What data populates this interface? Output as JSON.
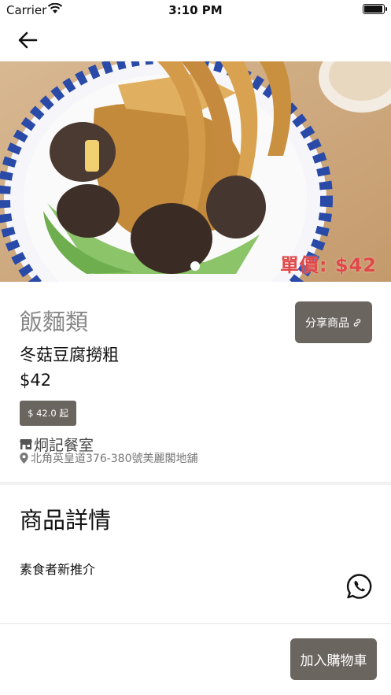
{
  "status_bar": {
    "carrier": "Carrier",
    "time": "3:10 PM"
  },
  "nav": {
    "back_icon": "arrow-left-icon"
  },
  "hero": {
    "price_overlay": "單價: $42",
    "carousel_dots": 1
  },
  "product": {
    "category": "飯麵類",
    "name": "冬菇豆腐撈粗",
    "price": "$42",
    "min_price_badge": "$ 42.0 起",
    "share_label": "分享商品",
    "share_icon": "link-icon"
  },
  "shop": {
    "name": "炯記餐室",
    "shop_icon": "store-icon",
    "address": "北角英皇道376-380號美麗閣地舖",
    "address_icon": "location-pin-icon"
  },
  "details": {
    "title": "商品詳情",
    "description": "素食者新推介",
    "contact_icon": "whatsapp-icon"
  },
  "footer": {
    "add_to_cart_label": "加入購物車"
  },
  "colors": {
    "button_bg": "#6b655f",
    "price_overlay": "#e04848",
    "category_text": "#888888"
  }
}
